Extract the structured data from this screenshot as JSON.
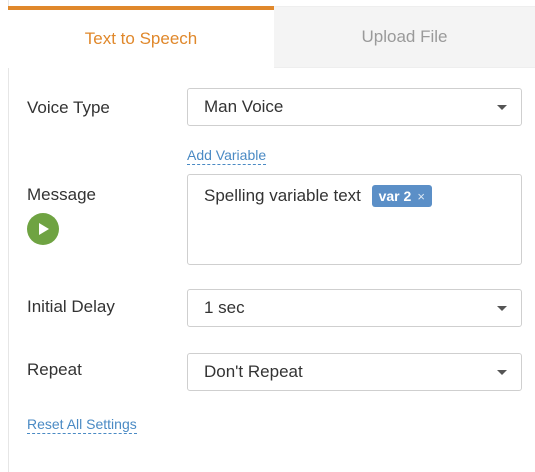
{
  "tabs": [
    {
      "label": "Text to Speech",
      "active": true
    },
    {
      "label": "Upload File",
      "active": false
    }
  ],
  "voice_type": {
    "label": "Voice Type",
    "value": "Man Voice"
  },
  "add_variable": {
    "label": "Add Variable"
  },
  "message": {
    "label": "Message",
    "text": "Spelling variable text",
    "variable_chip": "var 2",
    "chip_close": "×"
  },
  "initial_delay": {
    "label": "Initial Delay",
    "value": "1 sec"
  },
  "repeat": {
    "label": "Repeat",
    "value": "Don't Repeat"
  },
  "reset": {
    "label": "Reset All Settings"
  },
  "colors": {
    "accent": "#e0882b",
    "link": "#4a8ac4",
    "chip": "#5b8fc7",
    "play": "#6fa342"
  },
  "icons": {
    "play": "play-icon",
    "caret": "chevron-down-icon",
    "chip_close": "close-icon"
  }
}
